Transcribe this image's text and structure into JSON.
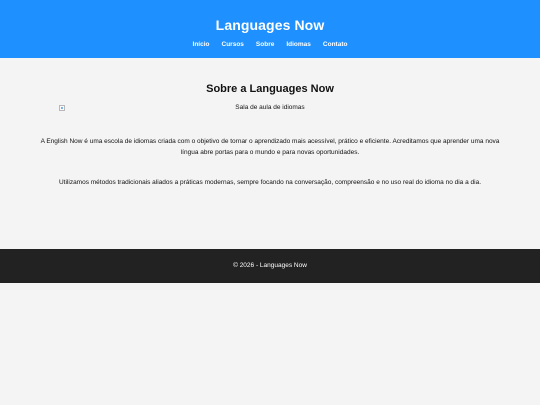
{
  "header": {
    "title": "Languages Now",
    "nav": [
      {
        "label": "Início"
      },
      {
        "label": "Cursos"
      },
      {
        "label": "Sobre"
      },
      {
        "label": "Idiomas"
      },
      {
        "label": "Contato"
      }
    ]
  },
  "main": {
    "title": "Sobre a Languages Now",
    "image_alt": "Sala de aula de idiomas",
    "paragraphs": [
      "A English Now é uma escola de idiomas criada com o objetivo de tornar o aprendizado mais acessível, prático e eficiente. Acreditamos que aprender uma nova língua abre portas para o mundo e para novas oportunidades.",
      "Utilizamos métodos tradicionais aliados a práticas modernas, sempre focando na conversação, compreensão e no uso real do idioma no dia a dia."
    ]
  },
  "footer": {
    "text": "© 2026 - Languages Now"
  },
  "colors": {
    "header_bg": "#1e90ff",
    "page_bg": "#f4f4f4",
    "footer_bg": "#222222"
  },
  "icons": {
    "broken_image": "broken-image-icon"
  }
}
